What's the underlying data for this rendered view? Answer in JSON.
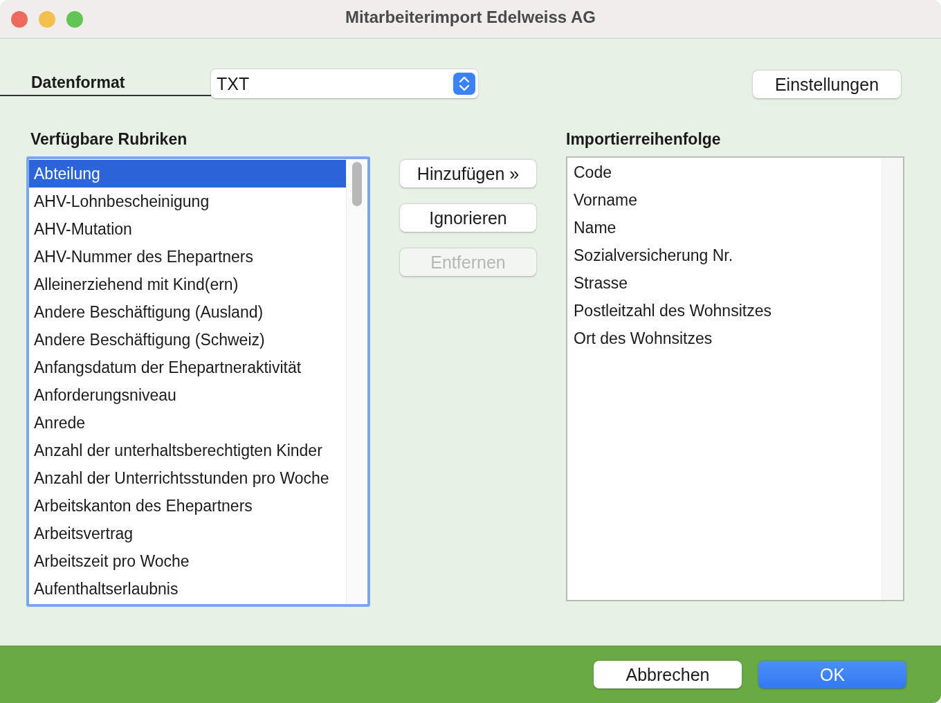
{
  "window": {
    "title": "Mitarbeiterimport Edelweiss AG"
  },
  "format": {
    "label": "Datenformat",
    "value": "TXT"
  },
  "settings_button": {
    "label": "Einstellungen",
    "disabled": false
  },
  "available": {
    "heading": "Verfügbare Rubriken",
    "focused": true,
    "items": [
      {
        "label": "Abteilung",
        "selected": true
      },
      {
        "label": "AHV-Lohnbescheinigung",
        "selected": false
      },
      {
        "label": "AHV-Mutation",
        "selected": false
      },
      {
        "label": "AHV-Nummer des Ehepartners",
        "selected": false
      },
      {
        "label": "Alleinerziehend mit Kind(ern)",
        "selected": false
      },
      {
        "label": "Andere Beschäftigung (Ausland)",
        "selected": false
      },
      {
        "label": "Andere Beschäftigung (Schweiz)",
        "selected": false
      },
      {
        "label": "Anfangsdatum der Ehepartneraktivität",
        "selected": false
      },
      {
        "label": "Anforderungsniveau",
        "selected": false
      },
      {
        "label": "Anrede",
        "selected": false
      },
      {
        "label": "Anzahl der unterhaltsberechtigten Kinder",
        "selected": false
      },
      {
        "label": "Anzahl der Unterrichtsstunden pro Woche",
        "selected": false
      },
      {
        "label": "Arbeitskanton des Ehepartners",
        "selected": false
      },
      {
        "label": "Arbeitsvertrag",
        "selected": false
      },
      {
        "label": "Arbeitszeit pro Woche",
        "selected": false
      },
      {
        "label": "Aufenthaltserlaubnis",
        "selected": false
      }
    ]
  },
  "actions": [
    {
      "label": "Hinzufügen »",
      "disabled": false
    },
    {
      "label": "Ignorieren",
      "disabled": false
    },
    {
      "label": "Entfernen",
      "disabled": true
    }
  ],
  "import_order": {
    "heading": "Importierreihenfolge",
    "focused": false,
    "items": [
      {
        "label": "Code",
        "selected": false
      },
      {
        "label": "Vorname",
        "selected": false
      },
      {
        "label": "Name",
        "selected": false
      },
      {
        "label": "Sozialversicherung Nr.",
        "selected": false
      },
      {
        "label": "Strasse",
        "selected": false
      },
      {
        "label": "Postleitzahl des Wohnsitzes",
        "selected": false
      },
      {
        "label": "Ort des Wohnsitzes",
        "selected": false
      }
    ]
  },
  "footer_buttons": [
    {
      "label": "Abbrechen",
      "default": false
    },
    {
      "label": "OK",
      "default": true
    }
  ]
}
